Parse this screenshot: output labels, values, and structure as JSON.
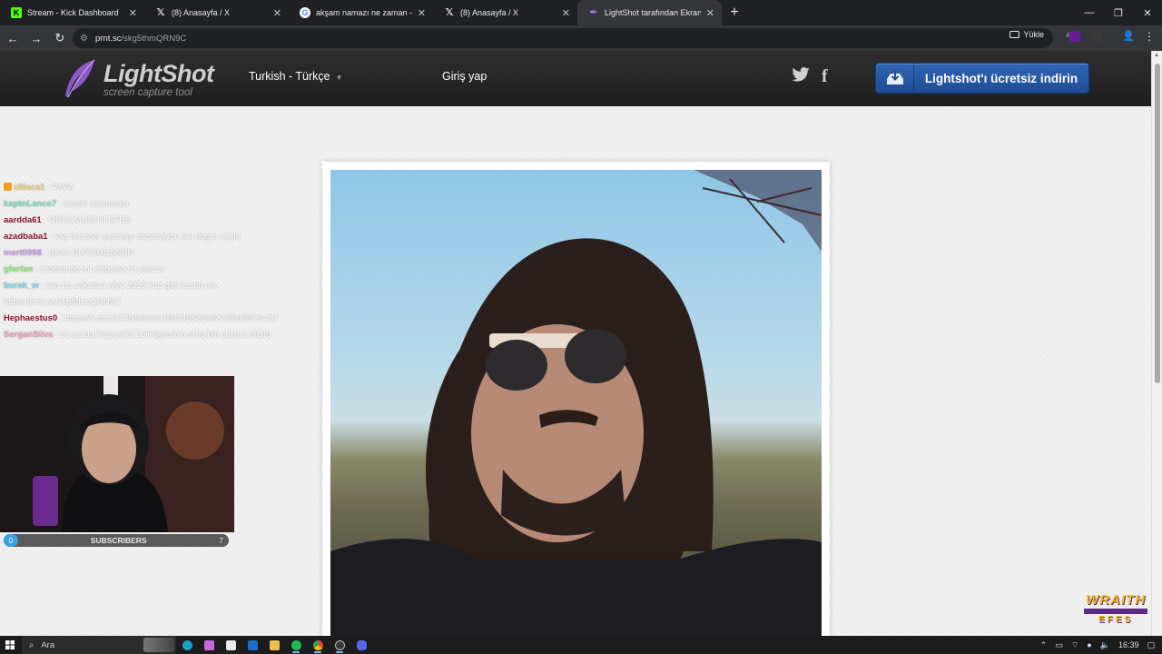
{
  "tabs": [
    {
      "label": "Stream - Kick Dashboard",
      "icon": "kick-icon",
      "active": false
    },
    {
      "label": "(8) Anasayfa / X",
      "icon": "x-icon",
      "active": false
    },
    {
      "label": "akşam namazı ne zaman - Goo",
      "icon": "google-icon",
      "active": false
    },
    {
      "label": "(8) Anasayfa / X",
      "icon": "x-icon",
      "active": false
    },
    {
      "label": "LightShot tarafından Ekran Gör",
      "icon": "lightshot-icon",
      "active": true
    }
  ],
  "address": {
    "host": "prnt.sc",
    "path": "/skg5thmQRN9C"
  },
  "toolbar": {
    "upload_label": "Yükle"
  },
  "lightshot": {
    "brand": "LightShot",
    "tagline": "screen capture tool",
    "language": "Turkish - Türkçe",
    "login": "Giriş yap",
    "download": "Lightshot'ı ücretsiz indirin"
  },
  "chat": [
    {
      "user": "xMaca1",
      "msg": ": PAPA",
      "badge": true,
      "style": "light"
    },
    {
      "user": "kaptnLance7",
      "msg": ": bende istemesim",
      "style": "light"
    },
    {
      "user": "aardda61",
      "msg": ": ORUÇMUSUN EFES",
      "style": "dark"
    },
    {
      "user": "azadbaba1",
      "msg": ": kaç transfer yapmayı düşünüyon lan dogru söyle",
      "style": "dark"
    },
    {
      "user": "mert0998",
      "msg": ": BAYA BÜYÜMÜŞSÜN",
      "style": "light"
    },
    {
      "user": "gferfan",
      "msg": ": zaotsende mi chipsien mi olacak",
      "style": "light"
    },
    {
      "user": "burak_w",
      "msg": ": sen bu sakalları niye 2019 kep gibi kestin mk",
      "style": "light"
    },
    {
      "user": "",
      "msg": "https://prnt.sc/skg5thmQRN9C",
      "style": "plain"
    },
    {
      "user": "Hephaestus0",
      "msg": ": https://x.com/CNN/status/1902465224627331198?s=20",
      "style": "dark"
    },
    {
      "user": "SerganSilva",
      "msg": ": bu arada karşıyaka belediyesinin amq biri çukura düştü",
      "style": "light"
    }
  ],
  "subscribers": {
    "label": "SUBSCRIBERS",
    "current": "0",
    "goal": "7",
    "progress": 0
  },
  "overlay_logo": {
    "line1": "WRAITH",
    "line2": "EFES"
  },
  "taskbar": {
    "search_placeholder": "Ara",
    "time": "16:39"
  },
  "colors": {
    "accent": "#2f66b5",
    "kick": "#53fc18",
    "header": "#262626"
  }
}
